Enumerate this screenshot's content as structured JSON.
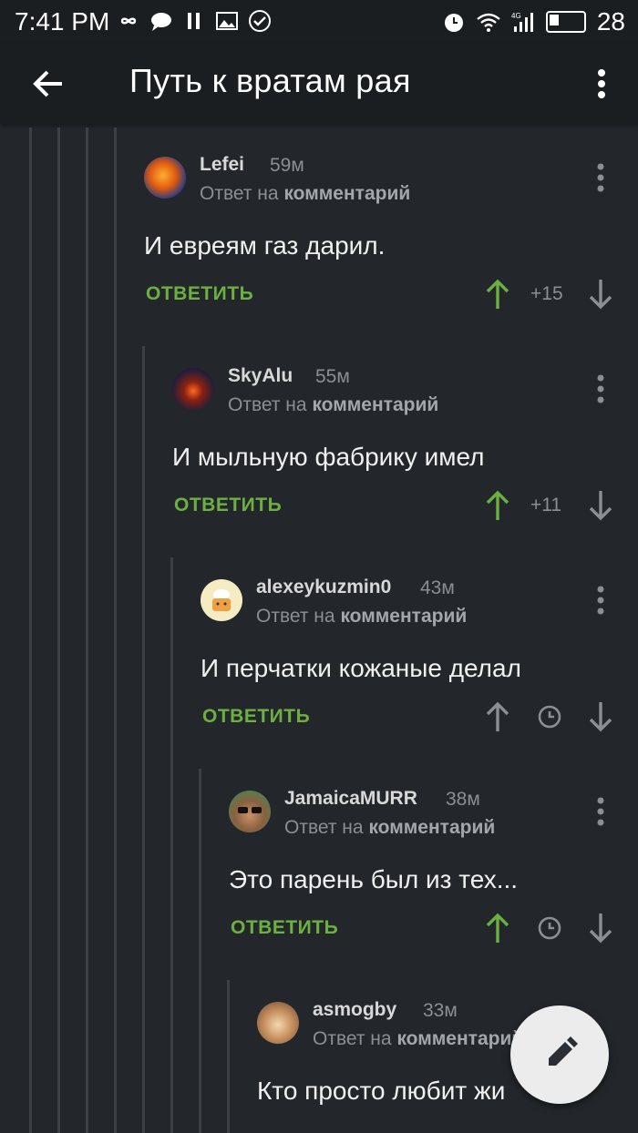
{
  "status_bar": {
    "time": "7:41 PM",
    "battery": "28",
    "network": "4G"
  },
  "app_bar": {
    "title": "Путь к вратам рая"
  },
  "reply_prefix": "Ответ на",
  "reply_target": "комментарий",
  "answer_label": "ОТВЕТИТЬ",
  "comments": [
    {
      "author": "Lefei",
      "time": "59м",
      "text": "И евреям газ дарил.",
      "score": "+15",
      "voted_up": true
    },
    {
      "author": "SkyAlu",
      "time": "55м",
      "text": "И мыльную фабрику имел",
      "score": "+11",
      "voted_up": true
    },
    {
      "author": "alexeykuzmin0",
      "time": "43м",
      "text": "И перчатки кожаные делал",
      "score": "",
      "voted_up": false
    },
    {
      "author": "JamaicaMURR",
      "time": "38м",
      "text": "Это парень был из тех...",
      "score": "",
      "voted_up": true
    },
    {
      "author": "asmogby",
      "time": "33м",
      "text": "Кто просто любит жи",
      "score": "",
      "voted_up": false
    }
  ],
  "colors": {
    "accent_green": "#6cb040",
    "background": "#23272b",
    "bar": "#1b1e21"
  },
  "icons": {
    "back": "arrow-left-icon",
    "menu": "kebab-icon",
    "fab": "pencil-icon"
  }
}
